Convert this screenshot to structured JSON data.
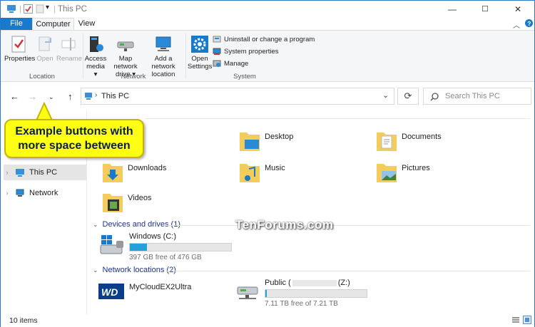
{
  "window": {
    "title": "This PC",
    "minimize_glyph": "—",
    "maximize_glyph": "☐",
    "close_glyph": "✕"
  },
  "ribbon_tabs": {
    "file": "File",
    "computer": "Computer",
    "view": "View"
  },
  "ribbon": {
    "location": {
      "properties": "Properties",
      "open": "Open",
      "rename": "Rename",
      "group": "Location"
    },
    "network": {
      "access_media_line1": "Access",
      "access_media_line2": "media ▾",
      "map_drive_line1": "Map network",
      "map_drive_line2": "drive ▾",
      "add_location_line1": "Add a network",
      "add_location_line2": "location",
      "group": "Network"
    },
    "system": {
      "open_settings_line1": "Open",
      "open_settings_line2": "Settings",
      "uninstall": "Uninstall or change a program",
      "system_properties": "System properties",
      "manage": "Manage",
      "group": "System"
    }
  },
  "address": {
    "path": "This PC",
    "search_placeholder": "Search This PC"
  },
  "nav_pane": {
    "items": [
      {
        "label": "This PC",
        "icon": "computer-icon",
        "selected": true
      },
      {
        "label": "Network",
        "icon": "network-icon",
        "selected": false
      }
    ]
  },
  "folders": [
    {
      "label": "3D Objects",
      "visible_label": "jects",
      "icon": "3d-objects-folder-icon"
    },
    {
      "label": "Desktop",
      "icon": "desktop-folder-icon"
    },
    {
      "label": "Documents",
      "icon": "documents-folder-icon"
    },
    {
      "label": "Downloads",
      "icon": "downloads-folder-icon"
    },
    {
      "label": "Music",
      "icon": "music-folder-icon"
    },
    {
      "label": "Pictures",
      "icon": "pictures-folder-icon"
    },
    {
      "label": "Videos",
      "icon": "videos-folder-icon"
    }
  ],
  "devices": {
    "header": "Devices and drives (1)",
    "drives": [
      {
        "name": "Windows (C:)",
        "free_text": "397 GB free of 476 GB",
        "used_fraction": 0.17
      }
    ]
  },
  "network_locations": {
    "header": "Network locations (2)",
    "items": [
      {
        "name": "MyCloudEX2Ultra",
        "icon": "wd-logo-icon"
      },
      {
        "name_prefix": "Public (",
        "name_suffix": "(Z:)",
        "free_text": "7.11 TB free of 7.21 TB",
        "used_fraction": 0.014
      }
    ]
  },
  "status": {
    "items_count": "10 items"
  },
  "callout": {
    "line1": "Example buttons with",
    "line2": "more space between"
  },
  "watermark": "TenForums.com",
  "colors": {
    "accent": "#1979ca",
    "drive_bar": "#26a0da",
    "callout": "#ffff14"
  }
}
